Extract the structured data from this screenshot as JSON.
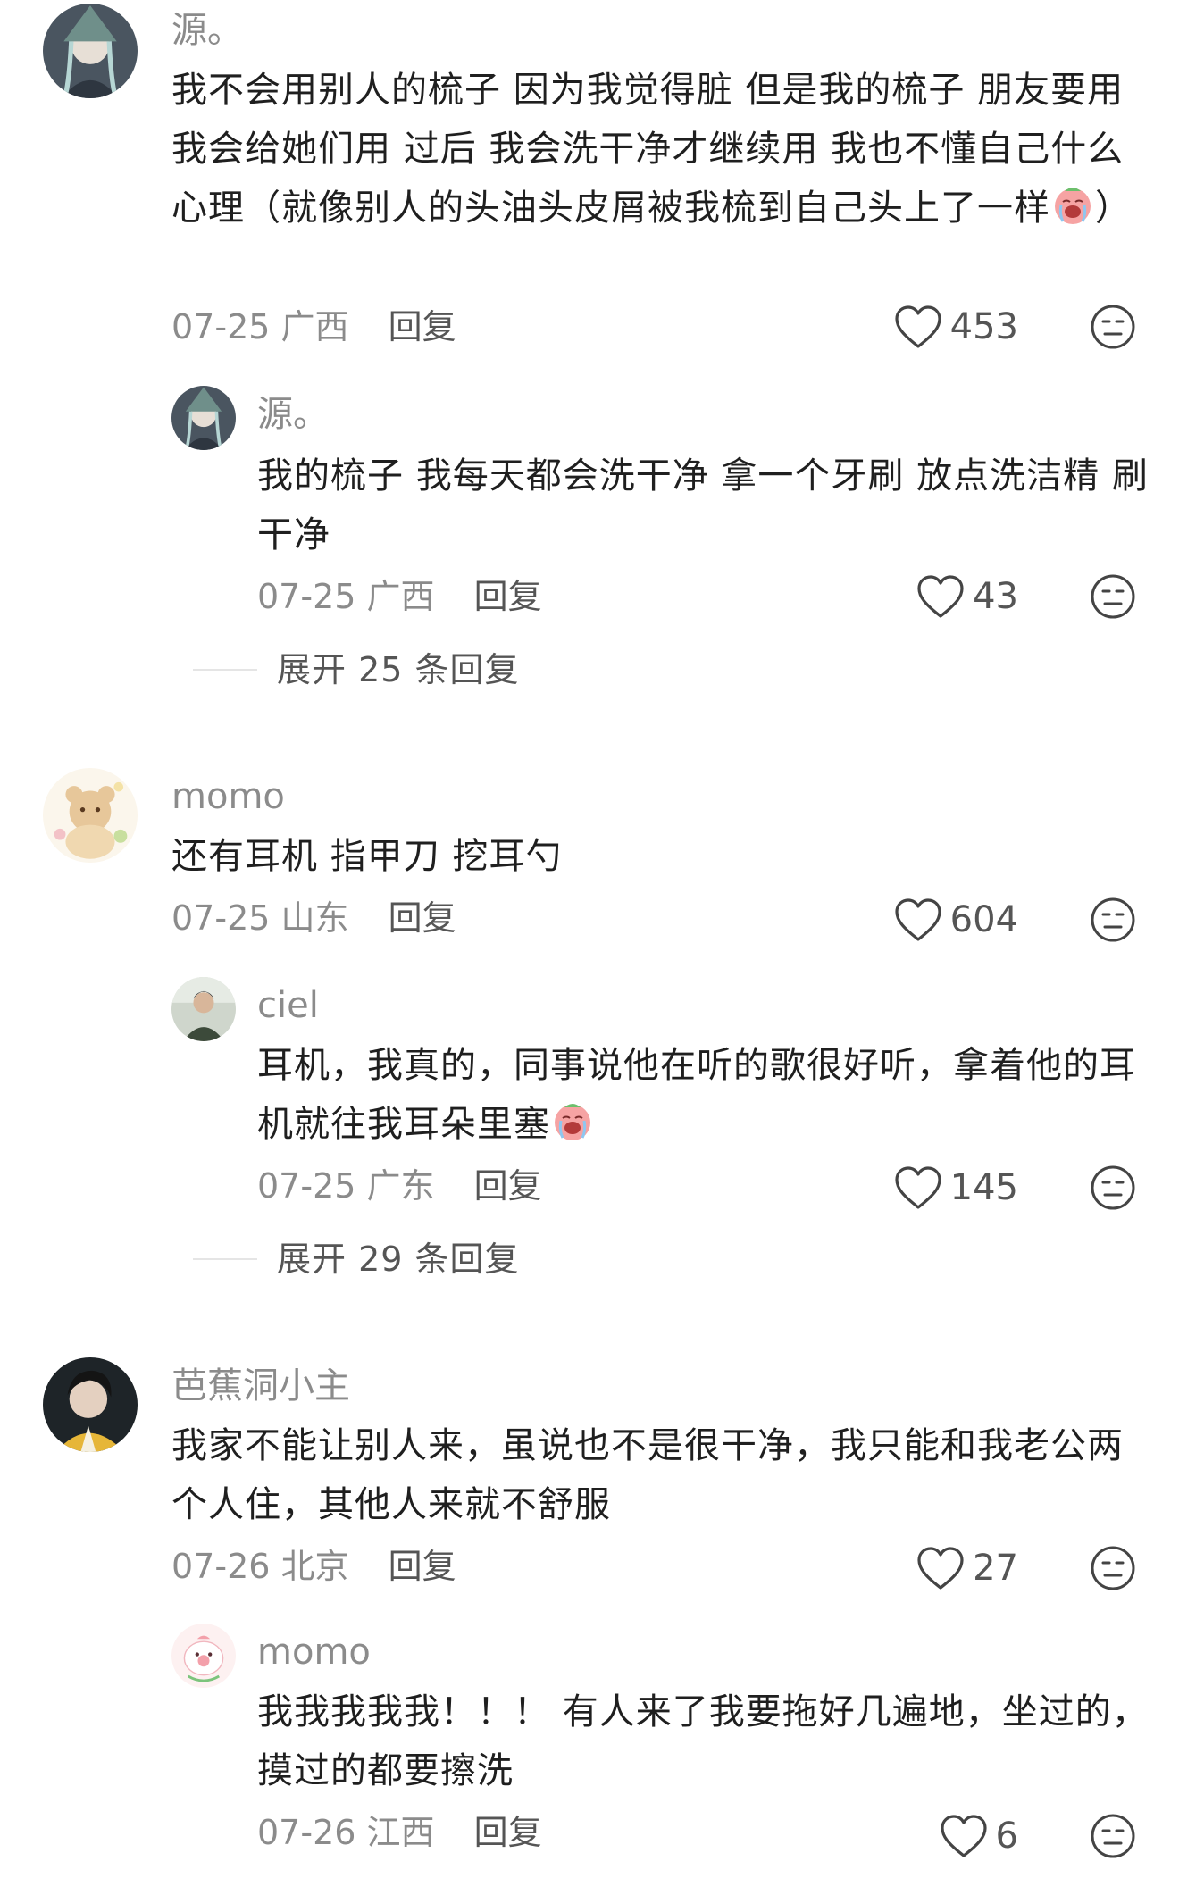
{
  "comments": [
    {
      "username": "源。",
      "text_a": "我不会用别人的梳子 因为我觉得脏 但是我的梳子 朋友要用 我会给她们用 过后 我会洗干净才继续用 我也不懂自己什么心理（就像别人的头油头皮屑被我梳到自己头上了一样",
      "text_b": "）",
      "emoji": "crying-face",
      "date": "07-25",
      "location": "广西",
      "reply_label": "回复",
      "likes": "453",
      "replies": [
        {
          "username": "源。",
          "text": "我的梳子 我每天都会洗干净 拿一个牙刷 放点洗洁精 刷干净",
          "date": "07-25",
          "location": "广西",
          "reply_label": "回复",
          "likes": "43"
        }
      ],
      "expand_label": "展开 25 条回复"
    },
    {
      "username": "momo",
      "text": "还有耳机 指甲刀 挖耳勺",
      "date": "07-25",
      "location": "山东",
      "reply_label": "回复",
      "likes": "604",
      "replies": [
        {
          "username": "ciel",
          "text": "耳机，我真的，同事说他在听的歌很好听，拿着他的耳机就往我耳朵里塞",
          "emoji": "crying-face",
          "date": "07-25",
          "location": "广东",
          "reply_label": "回复",
          "likes": "145"
        }
      ],
      "expand_label": "展开 29 条回复"
    },
    {
      "username": "芭蕉洞小主",
      "text": "我家不能让别人来，虽说也不是很干净，我只能和我老公两个人住，其他人来就不舒服",
      "date": "07-26",
      "location": "北京",
      "reply_label": "回复",
      "likes": "27",
      "replies": [
        {
          "username": "momo",
          "text": "我我我我我！！！ 有人来了我要拖好几遍地，坐过的，摸过的都要擦洗",
          "date": "07-26",
          "location": "江西",
          "reply_label": "回复",
          "likes": "6"
        }
      ]
    }
  ],
  "colors": {
    "username": "#8b8b8b",
    "text": "#1f1f1f",
    "meta": "#8b8b8b",
    "action": "#555555",
    "divider": "#e5e5e5"
  },
  "icons": {
    "like": "heart-outline-icon",
    "dislike": "neutral-face-icon",
    "emoji": "crying-face"
  }
}
